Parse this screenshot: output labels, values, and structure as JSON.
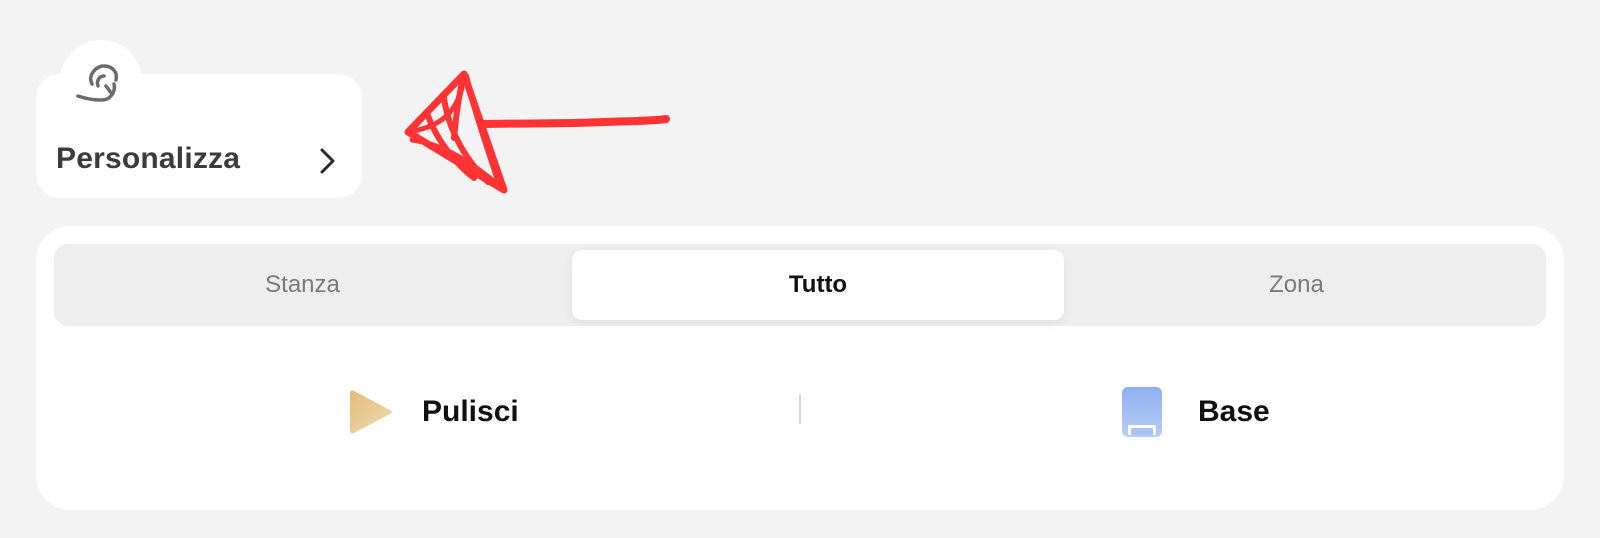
{
  "custom_card": {
    "label": "Personalizza",
    "icon": "fan-blades-icon",
    "chevron": "chevron-right-icon"
  },
  "annotation": {
    "color": "#ff3333",
    "description": "red-hand-drawn-arrow"
  },
  "mode_tabs": {
    "items": [
      "Stanza",
      "Tutto",
      "Zona"
    ],
    "selected": "Tutto"
  },
  "actions": {
    "clean": {
      "label": "Pulisci",
      "icon": "play-icon",
      "color": "#e6c48a"
    },
    "dock": {
      "label": "Base",
      "icon": "dock-station-icon",
      "color": "#8fb0f0"
    }
  },
  "colors": {
    "background": "#f3f3f3",
    "card": "#ffffff",
    "segmented_bg": "#eeeeee",
    "text_dark": "#111111",
    "text_muted": "#7a7a7a"
  }
}
